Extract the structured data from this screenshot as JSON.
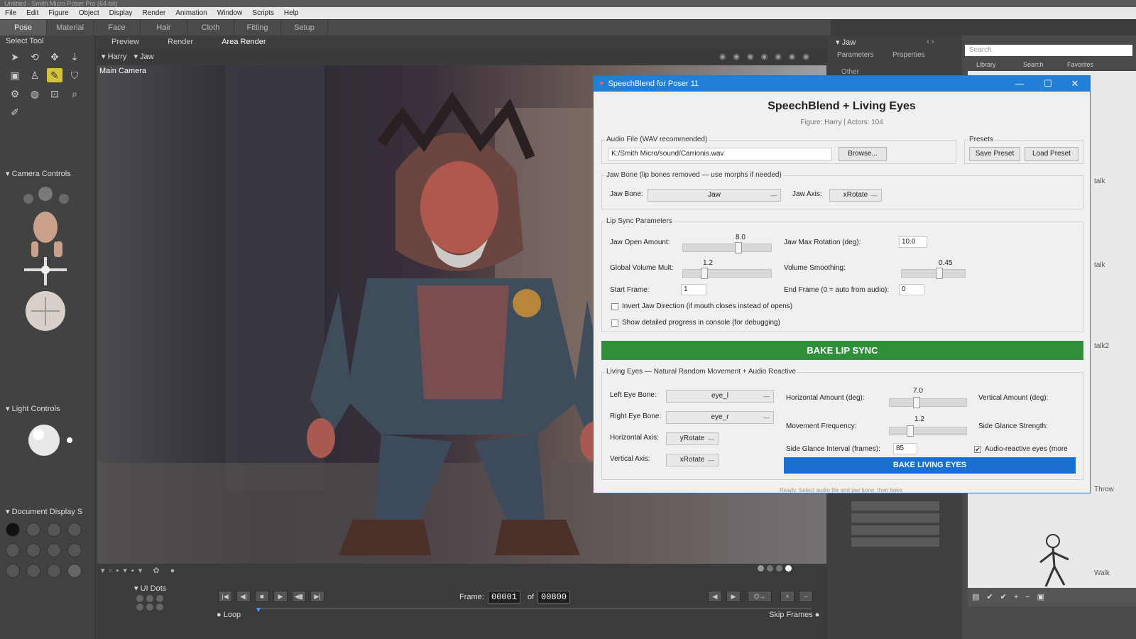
{
  "window_title": "Untitled - Smith Micro Poser Pro (64-bit)",
  "menu": [
    "File",
    "Edit",
    "Figure",
    "Object",
    "Display",
    "Render",
    "Animation",
    "Window",
    "Scripts",
    "Help"
  ],
  "rooms": [
    "Pose",
    "Material",
    "Face",
    "Hair",
    "Cloth",
    "Fitting",
    "Setup"
  ],
  "left": {
    "select_tool": "Select Tool",
    "camera_controls": "Camera Controls",
    "light_controls": "Light Controls",
    "document_display": "Document Display S",
    "ui_dots": "UI Dots"
  },
  "viewport": {
    "tabs": [
      "Preview",
      "Render",
      "Area Render"
    ],
    "figure": "Harry",
    "actor": "Jaw",
    "camera_label": "Main Camera"
  },
  "params": {
    "actor": "Jaw",
    "tab_parameters": "Parameters",
    "tab_properties": "Properties",
    "other": "Other"
  },
  "library": {
    "search_placeholder": "Search",
    "tab_library": "Library",
    "tab_search": "Search",
    "tab_favorites": "Favorites",
    "items": [
      "talk",
      "talk",
      "talk2",
      "Throw",
      "Walk"
    ]
  },
  "dialog": {
    "title": "SpeechBlend for Poser 11",
    "heading": "SpeechBlend  + Living Eyes",
    "subtitle": "Figure: Harry  |  Actors: 104",
    "audio_group": "Audio File (WAV recommended)",
    "audio_path": "K:/Smith Micro/sound/Carrionis.wav",
    "browse": "Browse...",
    "presets_group": "Presets",
    "save_preset": "Save Preset",
    "load_preset": "Load Preset",
    "jaw_group": "Jaw Bone (lip bones removed — use morphs if needed)",
    "jaw_bone_label": "Jaw Bone:",
    "jaw_bone_value": "Jaw",
    "jaw_axis_label": "Jaw Axis:",
    "jaw_axis_value": "xRotate",
    "lip_group": "Lip Sync Parameters",
    "jaw_open_label": "Jaw Open Amount:",
    "jaw_open_value": "8.0",
    "jaw_open_fraction": 0.63,
    "jaw_max_label": "Jaw Max Rotation (deg):",
    "jaw_max_value": "10.0",
    "gvm_label": "Global Volume Mult:",
    "gvm_value": "1.2",
    "gvm_fraction": 0.24,
    "vs_label": "Volume Smoothing:",
    "vs_value": "0.45",
    "vs_fraction": 0.6,
    "start_frame_label": "Start Frame:",
    "start_frame_value": "1",
    "end_frame_label": "End Frame (0 = auto from audio):",
    "end_frame_value": "0",
    "invert_jaw": "Invert Jaw Direction (if mouth closes instead of opens)",
    "show_progress": "Show detailed progress in console (for debugging)",
    "bake_lip": "BAKE LIP SYNC",
    "eyes_group": "Living Eyes — Natural Random Movement + Audio Reactive",
    "left_eye_label": "Left Eye Bone:",
    "left_eye_value": "eye_l",
    "right_eye_label": "Right Eye Bone:",
    "right_eye_value": "eye_r",
    "h_axis_label": "Horizontal Axis:",
    "h_axis_value": "yRotate",
    "v_axis_label": "Vertical Axis:",
    "v_axis_value": "xRotate",
    "h_amount_label": "Horizontal Amount (deg):",
    "h_amount_value": "7.0",
    "h_amount_fraction": 0.35,
    "v_amount_label": "Vertical Amount (deg):",
    "move_freq_label": "Movement Frequency:",
    "move_freq_value": "1.2",
    "move_freq_fraction": 0.27,
    "side_glance_label": "Side Glance Strength:",
    "sgi_label": "Side Glance Interval (frames):",
    "sgi_value": "85",
    "audio_reactive": "Audio-reactive eyes (more",
    "bake_eyes": "BAKE LIVING EYES",
    "status": "Ready. Select audio file and jaw bone, then bake."
  },
  "timeline": {
    "frame_label": "Frame:",
    "frame_current": "00001",
    "of_label": "of",
    "frame_total": "00800",
    "loop": "Loop",
    "skip_frames": "Skip Frames"
  }
}
